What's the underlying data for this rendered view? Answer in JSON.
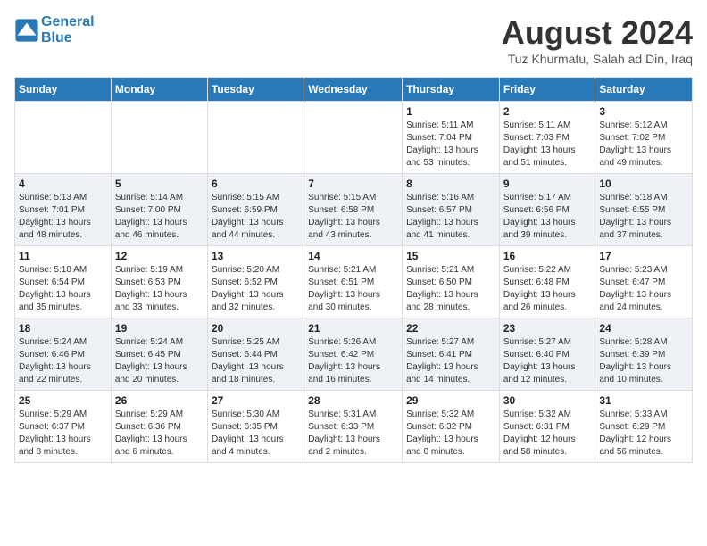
{
  "header": {
    "logo_line1": "General",
    "logo_line2": "Blue",
    "title": "August 2024",
    "subtitle": "Tuz Khurmatu, Salah ad Din, Iraq"
  },
  "calendar": {
    "days_of_week": [
      "Sunday",
      "Monday",
      "Tuesday",
      "Wednesday",
      "Thursday",
      "Friday",
      "Saturday"
    ],
    "weeks": [
      [
        {
          "day": "",
          "info": ""
        },
        {
          "day": "",
          "info": ""
        },
        {
          "day": "",
          "info": ""
        },
        {
          "day": "",
          "info": ""
        },
        {
          "day": "1",
          "info": "Sunrise: 5:11 AM\nSunset: 7:04 PM\nDaylight: 13 hours\nand 53 minutes."
        },
        {
          "day": "2",
          "info": "Sunrise: 5:11 AM\nSunset: 7:03 PM\nDaylight: 13 hours\nand 51 minutes."
        },
        {
          "day": "3",
          "info": "Sunrise: 5:12 AM\nSunset: 7:02 PM\nDaylight: 13 hours\nand 49 minutes."
        }
      ],
      [
        {
          "day": "4",
          "info": "Sunrise: 5:13 AM\nSunset: 7:01 PM\nDaylight: 13 hours\nand 48 minutes."
        },
        {
          "day": "5",
          "info": "Sunrise: 5:14 AM\nSunset: 7:00 PM\nDaylight: 13 hours\nand 46 minutes."
        },
        {
          "day": "6",
          "info": "Sunrise: 5:15 AM\nSunset: 6:59 PM\nDaylight: 13 hours\nand 44 minutes."
        },
        {
          "day": "7",
          "info": "Sunrise: 5:15 AM\nSunset: 6:58 PM\nDaylight: 13 hours\nand 43 minutes."
        },
        {
          "day": "8",
          "info": "Sunrise: 5:16 AM\nSunset: 6:57 PM\nDaylight: 13 hours\nand 41 minutes."
        },
        {
          "day": "9",
          "info": "Sunrise: 5:17 AM\nSunset: 6:56 PM\nDaylight: 13 hours\nand 39 minutes."
        },
        {
          "day": "10",
          "info": "Sunrise: 5:18 AM\nSunset: 6:55 PM\nDaylight: 13 hours\nand 37 minutes."
        }
      ],
      [
        {
          "day": "11",
          "info": "Sunrise: 5:18 AM\nSunset: 6:54 PM\nDaylight: 13 hours\nand 35 minutes."
        },
        {
          "day": "12",
          "info": "Sunrise: 5:19 AM\nSunset: 6:53 PM\nDaylight: 13 hours\nand 33 minutes."
        },
        {
          "day": "13",
          "info": "Sunrise: 5:20 AM\nSunset: 6:52 PM\nDaylight: 13 hours\nand 32 minutes."
        },
        {
          "day": "14",
          "info": "Sunrise: 5:21 AM\nSunset: 6:51 PM\nDaylight: 13 hours\nand 30 minutes."
        },
        {
          "day": "15",
          "info": "Sunrise: 5:21 AM\nSunset: 6:50 PM\nDaylight: 13 hours\nand 28 minutes."
        },
        {
          "day": "16",
          "info": "Sunrise: 5:22 AM\nSunset: 6:48 PM\nDaylight: 13 hours\nand 26 minutes."
        },
        {
          "day": "17",
          "info": "Sunrise: 5:23 AM\nSunset: 6:47 PM\nDaylight: 13 hours\nand 24 minutes."
        }
      ],
      [
        {
          "day": "18",
          "info": "Sunrise: 5:24 AM\nSunset: 6:46 PM\nDaylight: 13 hours\nand 22 minutes."
        },
        {
          "day": "19",
          "info": "Sunrise: 5:24 AM\nSunset: 6:45 PM\nDaylight: 13 hours\nand 20 minutes."
        },
        {
          "day": "20",
          "info": "Sunrise: 5:25 AM\nSunset: 6:44 PM\nDaylight: 13 hours\nand 18 minutes."
        },
        {
          "day": "21",
          "info": "Sunrise: 5:26 AM\nSunset: 6:42 PM\nDaylight: 13 hours\nand 16 minutes."
        },
        {
          "day": "22",
          "info": "Sunrise: 5:27 AM\nSunset: 6:41 PM\nDaylight: 13 hours\nand 14 minutes."
        },
        {
          "day": "23",
          "info": "Sunrise: 5:27 AM\nSunset: 6:40 PM\nDaylight: 13 hours\nand 12 minutes."
        },
        {
          "day": "24",
          "info": "Sunrise: 5:28 AM\nSunset: 6:39 PM\nDaylight: 13 hours\nand 10 minutes."
        }
      ],
      [
        {
          "day": "25",
          "info": "Sunrise: 5:29 AM\nSunset: 6:37 PM\nDaylight: 13 hours\nand 8 minutes."
        },
        {
          "day": "26",
          "info": "Sunrise: 5:29 AM\nSunset: 6:36 PM\nDaylight: 13 hours\nand 6 minutes."
        },
        {
          "day": "27",
          "info": "Sunrise: 5:30 AM\nSunset: 6:35 PM\nDaylight: 13 hours\nand 4 minutes."
        },
        {
          "day": "28",
          "info": "Sunrise: 5:31 AM\nSunset: 6:33 PM\nDaylight: 13 hours\nand 2 minutes."
        },
        {
          "day": "29",
          "info": "Sunrise: 5:32 AM\nSunset: 6:32 PM\nDaylight: 13 hours\nand 0 minutes."
        },
        {
          "day": "30",
          "info": "Sunrise: 5:32 AM\nSunset: 6:31 PM\nDaylight: 12 hours\nand 58 minutes."
        },
        {
          "day": "31",
          "info": "Sunrise: 5:33 AM\nSunset: 6:29 PM\nDaylight: 12 hours\nand 56 minutes."
        }
      ]
    ]
  }
}
